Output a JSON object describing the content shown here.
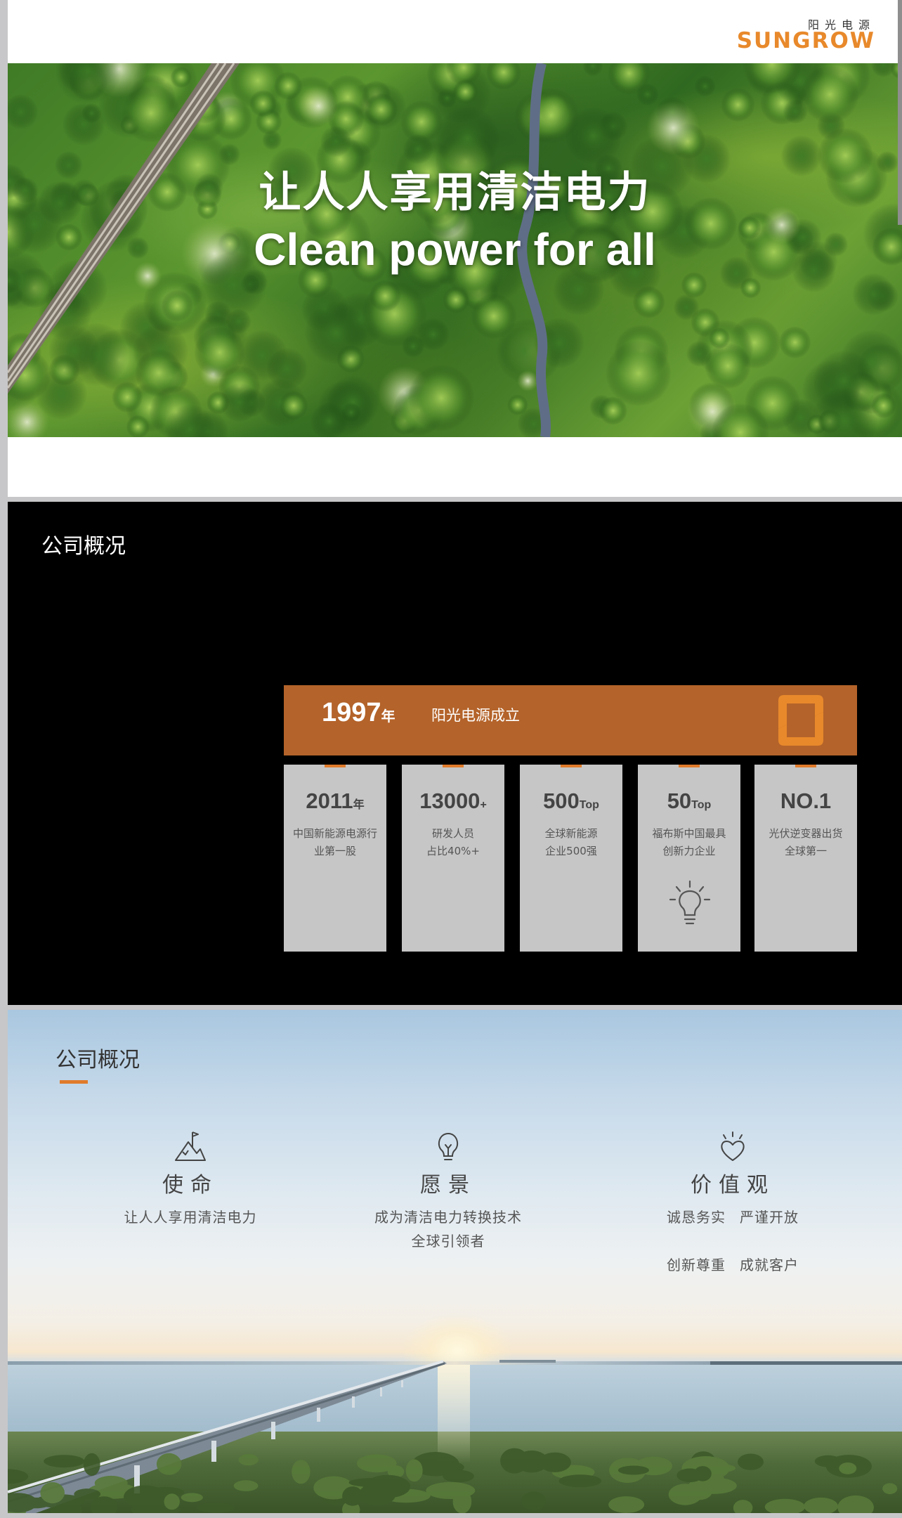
{
  "slide1": {
    "logo": {
      "cn": "阳光电源",
      "en": "SUNGROW"
    },
    "hero_cn": "让人人享用清洁电力",
    "hero_en": "Clean power for all"
  },
  "slide2": {
    "title": "公司概况",
    "founding": {
      "year": "1997",
      "year_unit": "年",
      "text": "阳光电源成立"
    },
    "stats": [
      {
        "num": "2011",
        "suffix": "年",
        "line1": "中国新能源电源行",
        "line2": "业第一股"
      },
      {
        "num": "13000",
        "suffix": "+",
        "line1": "研发人员",
        "line2": "占比40%+"
      },
      {
        "num": "500",
        "suffix": "Top",
        "line1": "全球新能源",
        "line2": "企业500强"
      },
      {
        "num": "50",
        "suffix": "Top",
        "line1": "福布斯中国最具",
        "line2": "创新力企业"
      },
      {
        "num": "NO.1",
        "suffix": "",
        "line1": "光伏逆变器出货",
        "line2": "全球第一"
      }
    ]
  },
  "slide3": {
    "title": "公司概况",
    "mission": {
      "title": "使命",
      "line1": "让人人享用清洁电力"
    },
    "vision": {
      "title": "愿景",
      "line1": "成为清洁电力转换技术",
      "line2": "全球引领者"
    },
    "values": {
      "title": "价值观",
      "items": [
        "诚恳务实",
        "严谨开放",
        "创新尊重",
        "成就客户"
      ]
    }
  },
  "colors": {
    "accent": "#e07b2b",
    "bar": "#b4632a",
    "card": "#c6c6c6"
  }
}
